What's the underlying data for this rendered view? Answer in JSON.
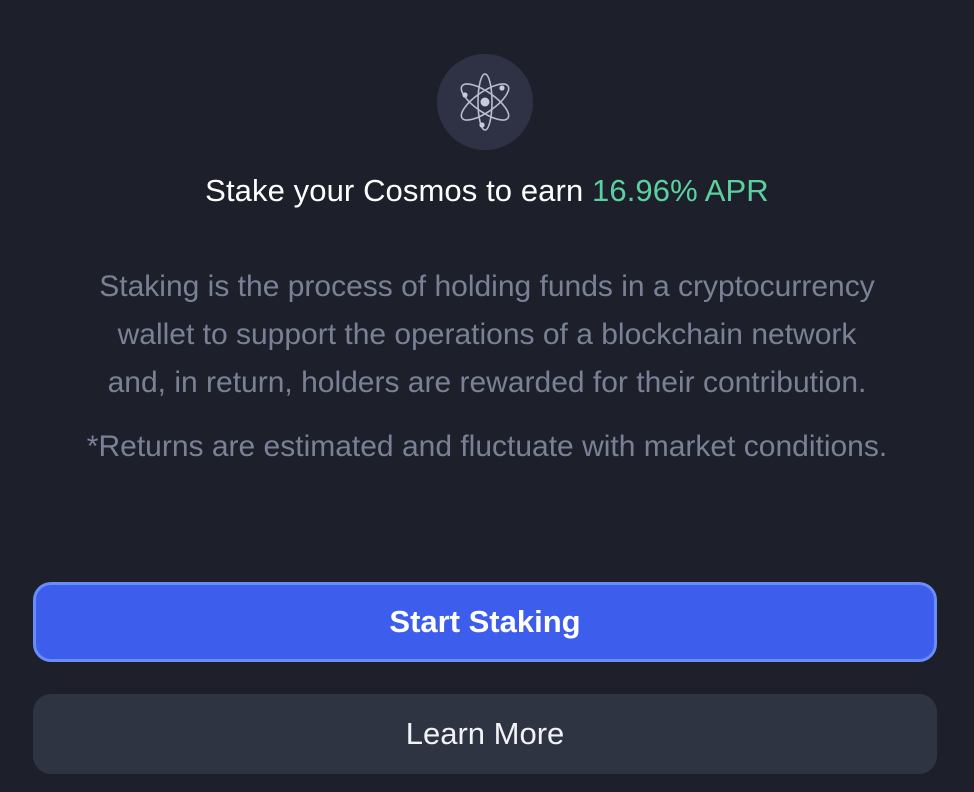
{
  "logo": {
    "icon": "cosmos-atom-icon"
  },
  "headline": {
    "prefix": "Stake your Cosmos to earn ",
    "apr": "16.96% APR"
  },
  "description": {
    "line1": "Staking is the process of holding funds in a cryptocurrency",
    "line2": "wallet to support the operations of a blockchain network",
    "line3": "and, in return, holders are rewarded for their contribution."
  },
  "disclaimer": "*Returns are estimated and fluctuate with market conditions.",
  "buttons": {
    "start_staking": "Start Staking",
    "learn_more": "Learn More"
  },
  "colors": {
    "background": "#1d202b",
    "accent_green": "#5ad19f",
    "primary_button": "#3d5ded",
    "secondary_button": "#2f3443",
    "muted_text": "#7a8196"
  }
}
